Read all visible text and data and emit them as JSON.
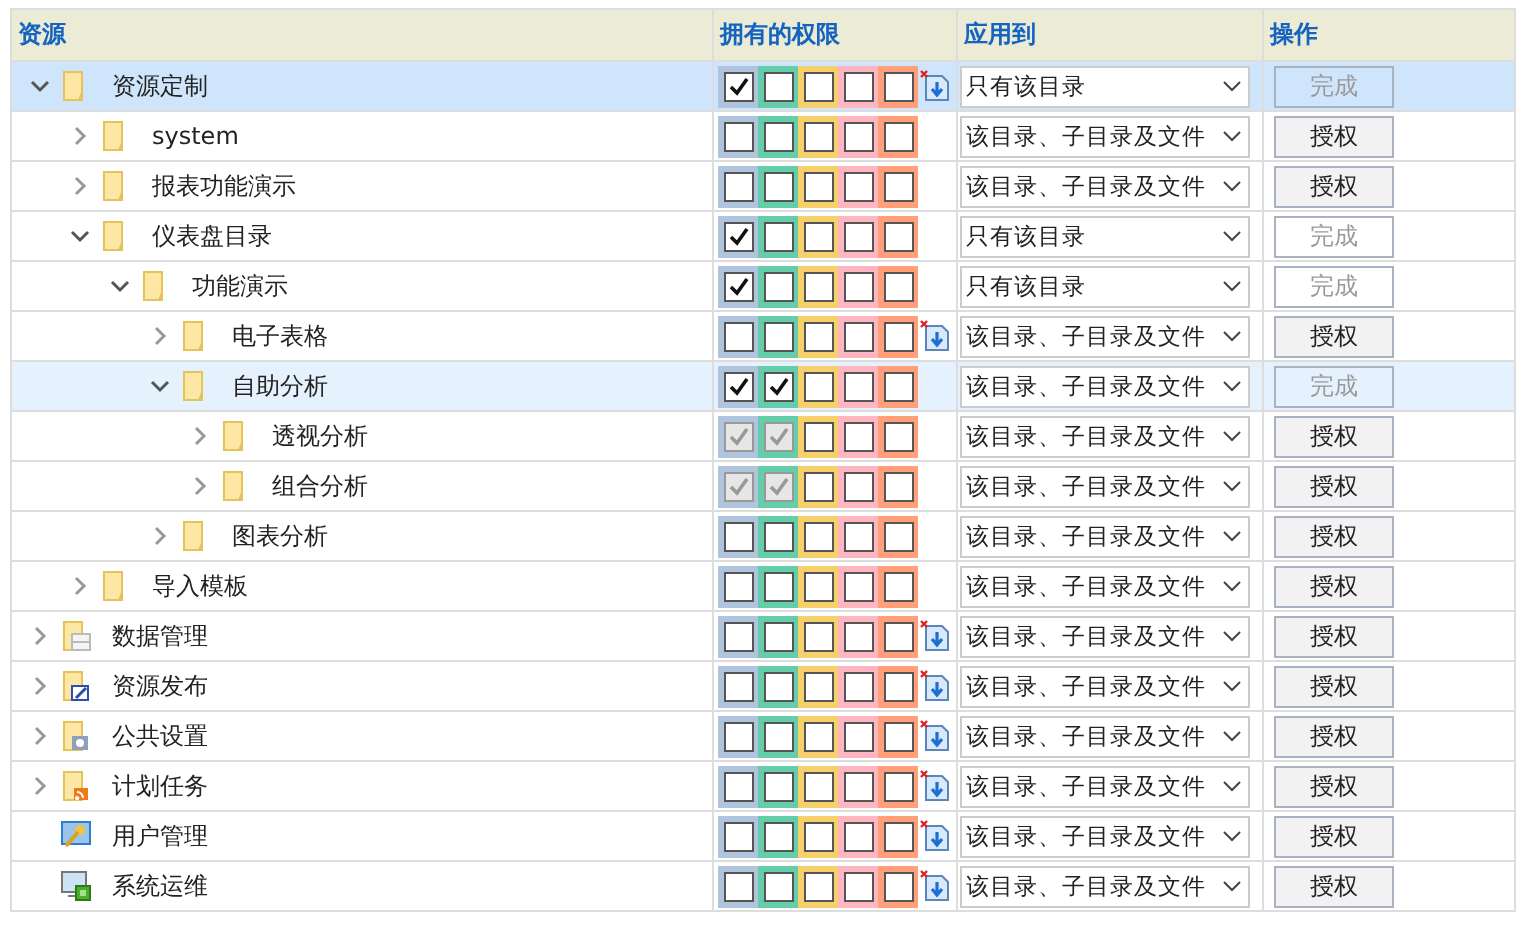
{
  "columns": [
    "资源",
    "拥有的权限",
    "应用到",
    "操作"
  ],
  "rows": [
    {
      "label": "资源定制",
      "kind": "folder",
      "expanded": true,
      "selected": true,
      "hovered": false,
      "export": true,
      "apply": "只有该目录",
      "action": {
        "label": "完成",
        "disabled": true
      },
      "permissions": [
        {
          "checked": true,
          "disabled": false
        },
        {
          "checked": false,
          "disabled": false
        },
        {
          "checked": false,
          "disabled": false
        },
        {
          "checked": false,
          "disabled": false
        },
        {
          "checked": false,
          "disabled": false
        }
      ],
      "children": [
        {
          "label": "system",
          "kind": "folder",
          "expanded": false,
          "selected": false,
          "hovered": false,
          "export": false,
          "apply": "该目录、子目录及文件",
          "action": {
            "label": "授权",
            "disabled": false
          },
          "permissions": [
            {
              "checked": false,
              "disabled": false
            },
            {
              "checked": false,
              "disabled": false
            },
            {
              "checked": false,
              "disabled": false
            },
            {
              "checked": false,
              "disabled": false
            },
            {
              "checked": false,
              "disabled": false
            }
          ]
        },
        {
          "label": "报表功能演示",
          "kind": "folder",
          "expanded": false,
          "selected": false,
          "hovered": false,
          "export": false,
          "apply": "该目录、子目录及文件",
          "action": {
            "label": "授权",
            "disabled": false
          },
          "permissions": [
            {
              "checked": false,
              "disabled": false
            },
            {
              "checked": false,
              "disabled": false
            },
            {
              "checked": false,
              "disabled": false
            },
            {
              "checked": false,
              "disabled": false
            },
            {
              "checked": false,
              "disabled": false
            }
          ]
        },
        {
          "label": "仪表盘目录",
          "kind": "folder",
          "expanded": true,
          "selected": false,
          "hovered": false,
          "export": false,
          "apply": "只有该目录",
          "action": {
            "label": "完成",
            "disabled": true
          },
          "permissions": [
            {
              "checked": true,
              "disabled": false
            },
            {
              "checked": false,
              "disabled": false
            },
            {
              "checked": false,
              "disabled": false
            },
            {
              "checked": false,
              "disabled": false
            },
            {
              "checked": false,
              "disabled": false
            }
          ],
          "children": [
            {
              "label": "功能演示",
              "kind": "folder",
              "expanded": true,
              "selected": false,
              "hovered": false,
              "export": false,
              "apply": "只有该目录",
              "action": {
                "label": "完成",
                "disabled": true
              },
              "permissions": [
                {
                  "checked": true,
                  "disabled": false
                },
                {
                  "checked": false,
                  "disabled": false
                },
                {
                  "checked": false,
                  "disabled": false
                },
                {
                  "checked": false,
                  "disabled": false
                },
                {
                  "checked": false,
                  "disabled": false
                }
              ],
              "children": [
                {
                  "label": "电子表格",
                  "kind": "folder",
                  "expanded": false,
                  "selected": false,
                  "hovered": false,
                  "export": true,
                  "apply": "该目录、子目录及文件",
                  "action": {
                    "label": "授权",
                    "disabled": false
                  },
                  "permissions": [
                    {
                      "checked": false,
                      "disabled": false
                    },
                    {
                      "checked": false,
                      "disabled": false
                    },
                    {
                      "checked": false,
                      "disabled": false
                    },
                    {
                      "checked": false,
                      "disabled": false
                    },
                    {
                      "checked": false,
                      "disabled": false
                    }
                  ]
                },
                {
                  "label": "自助分析",
                  "kind": "folder",
                  "expanded": true,
                  "selected": false,
                  "hovered": true,
                  "export": false,
                  "apply": "该目录、子目录及文件",
                  "action": {
                    "label": "完成",
                    "disabled": true
                  },
                  "permissions": [
                    {
                      "checked": true,
                      "disabled": false
                    },
                    {
                      "checked": true,
                      "disabled": false
                    },
                    {
                      "checked": false,
                      "disabled": false
                    },
                    {
                      "checked": false,
                      "disabled": false
                    },
                    {
                      "checked": false,
                      "disabled": false
                    }
                  ],
                  "children": [
                    {
                      "label": "透视分析",
                      "kind": "folder",
                      "expanded": false,
                      "selected": false,
                      "hovered": false,
                      "export": false,
                      "apply": "该目录、子目录及文件",
                      "action": {
                        "label": "授权",
                        "disabled": false
                      },
                      "permissions": [
                        {
                          "checked": true,
                          "disabled": true
                        },
                        {
                          "checked": true,
                          "disabled": true
                        },
                        {
                          "checked": false,
                          "disabled": false
                        },
                        {
                          "checked": false,
                          "disabled": false
                        },
                        {
                          "checked": false,
                          "disabled": false
                        }
                      ]
                    },
                    {
                      "label": "组合分析",
                      "kind": "folder",
                      "expanded": false,
                      "selected": false,
                      "hovered": false,
                      "export": false,
                      "apply": "该目录、子目录及文件",
                      "action": {
                        "label": "授权",
                        "disabled": false
                      },
                      "permissions": [
                        {
                          "checked": true,
                          "disabled": true
                        },
                        {
                          "checked": true,
                          "disabled": true
                        },
                        {
                          "checked": false,
                          "disabled": false
                        },
                        {
                          "checked": false,
                          "disabled": false
                        },
                        {
                          "checked": false,
                          "disabled": false
                        }
                      ]
                    }
                  ]
                },
                {
                  "label": "图表分析",
                  "kind": "folder",
                  "expanded": false,
                  "selected": false,
                  "hovered": false,
                  "export": false,
                  "apply": "该目录、子目录及文件",
                  "action": {
                    "label": "授权",
                    "disabled": false
                  },
                  "permissions": [
                    {
                      "checked": false,
                      "disabled": false
                    },
                    {
                      "checked": false,
                      "disabled": false
                    },
                    {
                      "checked": false,
                      "disabled": false
                    },
                    {
                      "checked": false,
                      "disabled": false
                    },
                    {
                      "checked": false,
                      "disabled": false
                    }
                  ]
                }
              ]
            }
          ]
        },
        {
          "label": "导入模板",
          "kind": "folder",
          "expanded": false,
          "selected": false,
          "hovered": false,
          "export": false,
          "apply": "该目录、子目录及文件",
          "action": {
            "label": "授权",
            "disabled": false
          },
          "permissions": [
            {
              "checked": false,
              "disabled": false
            },
            {
              "checked": false,
              "disabled": false
            },
            {
              "checked": false,
              "disabled": false
            },
            {
              "checked": false,
              "disabled": false
            },
            {
              "checked": false,
              "disabled": false
            }
          ]
        }
      ]
    },
    {
      "label": "数据管理",
      "kind": "data",
      "expanded": false,
      "selected": false,
      "hovered": false,
      "export": true,
      "apply": "该目录、子目录及文件",
      "action": {
        "label": "授权",
        "disabled": false
      },
      "permissions": [
        {
          "checked": false,
          "disabled": false
        },
        {
          "checked": false,
          "disabled": false
        },
        {
          "checked": false,
          "disabled": false
        },
        {
          "checked": false,
          "disabled": false
        },
        {
          "checked": false,
          "disabled": false
        }
      ]
    },
    {
      "label": "资源发布",
      "kind": "publish",
      "expanded": false,
      "selected": false,
      "hovered": false,
      "export": true,
      "apply": "该目录、子目录及文件",
      "action": {
        "label": "授权",
        "disabled": false
      },
      "permissions": [
        {
          "checked": false,
          "disabled": false
        },
        {
          "checked": false,
          "disabled": false
        },
        {
          "checked": false,
          "disabled": false
        },
        {
          "checked": false,
          "disabled": false
        },
        {
          "checked": false,
          "disabled": false
        }
      ]
    },
    {
      "label": "公共设置",
      "kind": "settings",
      "expanded": false,
      "selected": false,
      "hovered": false,
      "export": true,
      "apply": "该目录、子目录及文件",
      "action": {
        "label": "授权",
        "disabled": false
      },
      "permissions": [
        {
          "checked": false,
          "disabled": false
        },
        {
          "checked": false,
          "disabled": false
        },
        {
          "checked": false,
          "disabled": false
        },
        {
          "checked": false,
          "disabled": false
        },
        {
          "checked": false,
          "disabled": false
        }
      ]
    },
    {
      "label": "计划任务",
      "kind": "schedule",
      "expanded": false,
      "selected": false,
      "hovered": false,
      "export": true,
      "apply": "该目录、子目录及文件",
      "action": {
        "label": "授权",
        "disabled": false
      },
      "permissions": [
        {
          "checked": false,
          "disabled": false
        },
        {
          "checked": false,
          "disabled": false
        },
        {
          "checked": false,
          "disabled": false
        },
        {
          "checked": false,
          "disabled": false
        },
        {
          "checked": false,
          "disabled": false
        }
      ]
    },
    {
      "label": "用户管理",
      "kind": "user",
      "selected": false,
      "hovered": false,
      "export": true,
      "apply": "该目录、子目录及文件",
      "action": {
        "label": "授权",
        "disabled": false
      },
      "permissions": [
        {
          "checked": false,
          "disabled": false
        },
        {
          "checked": false,
          "disabled": false
        },
        {
          "checked": false,
          "disabled": false
        },
        {
          "checked": false,
          "disabled": false
        },
        {
          "checked": false,
          "disabled": false
        }
      ]
    },
    {
      "label": "系统运维",
      "kind": "system",
      "selected": false,
      "hovered": false,
      "export": true,
      "apply": "该目录、子目录及文件",
      "action": {
        "label": "授权",
        "disabled": false
      },
      "permissions": [
        {
          "checked": false,
          "disabled": false
        },
        {
          "checked": false,
          "disabled": false
        },
        {
          "checked": false,
          "disabled": false
        },
        {
          "checked": false,
          "disabled": false
        },
        {
          "checked": false,
          "disabled": false
        }
      ]
    }
  ]
}
